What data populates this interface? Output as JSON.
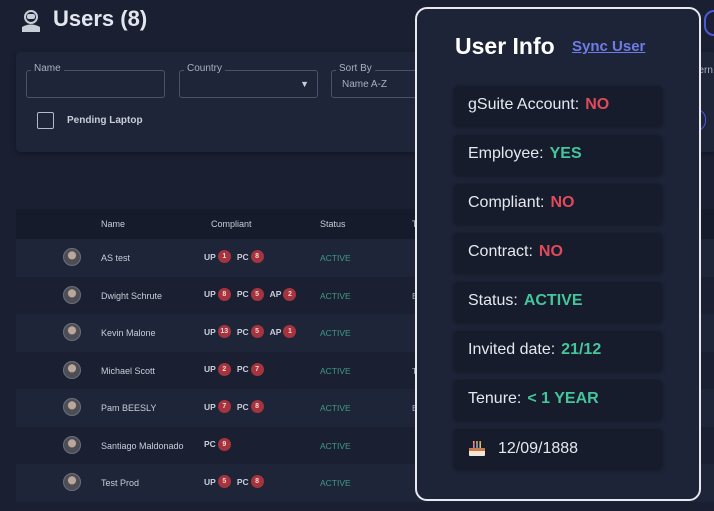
{
  "header": {
    "title": "Users (8)"
  },
  "filters": {
    "name_label": "Name",
    "country_label": "Country",
    "sort_label": "Sort By",
    "sort_value": "Name A-Z",
    "extern_label": "Extern",
    "pending_label": "Pending Laptop",
    "pill_label": "r"
  },
  "table": {
    "headers": {
      "name": "Name",
      "compliant": "Compliant",
      "status": "Status",
      "type": "Typ"
    },
    "rows": [
      {
        "name": "AS test",
        "compliant": [
          {
            "l": "UP",
            "n": "1"
          },
          {
            "l": "PC",
            "n": "8"
          }
        ],
        "status": "ACTIVE",
        "type": ""
      },
      {
        "name": "Dwight Schrute",
        "compliant": [
          {
            "l": "UP",
            "n": "8"
          },
          {
            "l": "PC",
            "n": "5"
          },
          {
            "l": "AP",
            "n": "2"
          }
        ],
        "status": "ACTIVE",
        "type": "Emp"
      },
      {
        "name": "Kevin Malone",
        "compliant": [
          {
            "l": "UP",
            "n": "13"
          },
          {
            "l": "PC",
            "n": "5"
          },
          {
            "l": "AP",
            "n": "1"
          }
        ],
        "status": "ACTIVE",
        "type": ""
      },
      {
        "name": "Michael Scott",
        "compliant": [
          {
            "l": "UP",
            "n": "2"
          },
          {
            "l": "PC",
            "n": "7"
          }
        ],
        "status": "ACTIVE",
        "type": "Test"
      },
      {
        "name": "Pam BEESLY",
        "compliant": [
          {
            "l": "UP",
            "n": "7"
          },
          {
            "l": "PC",
            "n": "8"
          }
        ],
        "status": "ACTIVE",
        "type": "EMP"
      },
      {
        "name": "Santiago Maldonado",
        "compliant": [
          {
            "l": "PC",
            "n": "9"
          }
        ],
        "status": "ACTIVE",
        "type": ""
      },
      {
        "name": "Test Prod",
        "compliant": [
          {
            "l": "UP",
            "n": "5"
          },
          {
            "l": "PC",
            "n": "8"
          }
        ],
        "status": "ACTIVE",
        "type": ""
      }
    ]
  },
  "user_info": {
    "title": "User Info",
    "sync_label": "Sync User",
    "items": [
      {
        "key": "gSuite Account:",
        "value": "NO",
        "tone": "red"
      },
      {
        "key": "Employee:",
        "value": "YES",
        "tone": "green"
      },
      {
        "key": "Compliant:",
        "value": "NO",
        "tone": "red"
      },
      {
        "key": "Contract:",
        "value": "NO",
        "tone": "red"
      },
      {
        "key": "Status:",
        "value": "ACTIVE",
        "tone": "green"
      },
      {
        "key": "Invited date:",
        "value": "21/12",
        "tone": "green"
      },
      {
        "key": "Tenure:",
        "value": "< 1 YEAR",
        "tone": "green"
      }
    ],
    "birthday_icon": "cake-icon",
    "birthday": "12/09/1888"
  },
  "colors": {
    "accent": "#3c4bd0",
    "danger": "#e04a5b",
    "success": "#44c59a",
    "badge": "#a6343e"
  }
}
